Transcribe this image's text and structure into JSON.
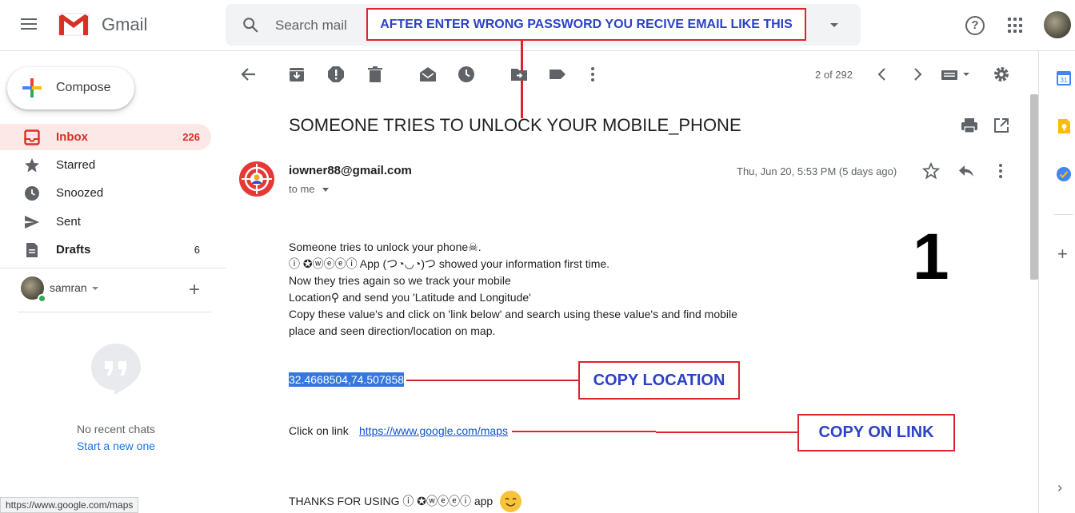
{
  "header": {
    "app_name": "Gmail",
    "search_placeholder": "Search mail"
  },
  "annotations": {
    "top": "AFTER ENTER WRONG PASSWORD YOU RECIVE EMAIL LIKE THIS",
    "copy_location": "COPY  LOCATION",
    "copy_link": "COPY ON LINK",
    "step_number": "1"
  },
  "sidebar": {
    "compose_label": "Compose",
    "items": [
      {
        "label": "Inbox",
        "count": "226",
        "icon": "inbox-icon"
      },
      {
        "label": "Starred",
        "count": "",
        "icon": "star-icon"
      },
      {
        "label": "Snoozed",
        "count": "",
        "icon": "clock-icon"
      },
      {
        "label": "Sent",
        "count": "",
        "icon": "send-icon"
      },
      {
        "label": "Drafts",
        "count": "6",
        "icon": "draft-icon"
      }
    ],
    "hangouts_user": "samran",
    "no_chats": "No recent chats",
    "start_new": "Start a new one"
  },
  "toolbar": {
    "pager": "2 of 292"
  },
  "email": {
    "subject": "SOMEONE TRIES TO UNLOCK YOUR MOBILE_PHONE",
    "sender": "iowner88@gmail.com",
    "to": "to me",
    "date": "Thu, Jun 20, 5:53 PM (5 days ago)",
    "body": [
      "Someone tries to unlock your phone☠.",
      "ⓘ ✪ⓦⓔⓔⓘ  App (つ◔◡◔)つ  showed your information first time.",
      "Now they tries again so we track your mobile",
      "Location⚲ and send you 'Latitude and Longitude'",
      "Copy these value's and click on 'link below' and search using these value's and find mobile",
      "place and seen direction/location on map."
    ],
    "coordinates": "32.4668504,74.507858",
    "click_label": "Click on link",
    "maps_link": "https://www.google.com/maps",
    "thanks_line": "THANKS FOR USING  ⓘ ✪ⓦⓔⓔⓘ  app"
  },
  "status_bar": {
    "url": "https://www.google.com/maps"
  },
  "colors": {
    "annotation_border": "#e0222c",
    "annotation_text": "#2b42c7",
    "inbox_active_bg": "#fce8e6",
    "inbox_active_text": "#d93025",
    "link": "#1155cc",
    "selection": "#3477e0"
  }
}
